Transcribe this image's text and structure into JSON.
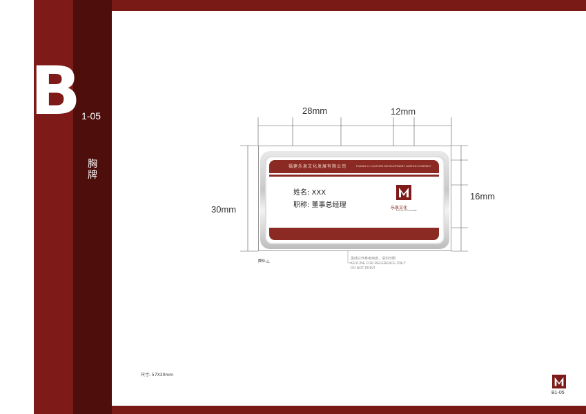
{
  "page": {
    "section_letter": "B",
    "section_code": "1-05",
    "section_title": "胸牌"
  },
  "dimensions": {
    "width_a": "28mm",
    "width_b": "12mm",
    "height_total": "30mm",
    "height_band": "16mm"
  },
  "badge": {
    "company_cn": "福建乐泉文化发展有限公司",
    "company_en": "FUJIAN YL CULTURE DEVELOPMENT LIMITED COMPANY",
    "name_label": "姓名: XXX",
    "title_label": "职称: 董事总经理",
    "logo_text": "乐泉文化",
    "logo_sub": "FUJIAN YL CULTURE"
  },
  "notes": {
    "figure_label": "图9-△",
    "keyline_cn": "黑线只作参考用途，请勿印刷",
    "keyline_en_1": "KEYLINE FOR REFERENCE ONLY",
    "keyline_en_2": "DO NOT PRINT",
    "size": "尺寸: 57X30mm"
  },
  "footer": {
    "code": "B1-05"
  },
  "colors": {
    "brand_red": "#7e1b18",
    "brand_dark": "#4e0f0c"
  }
}
